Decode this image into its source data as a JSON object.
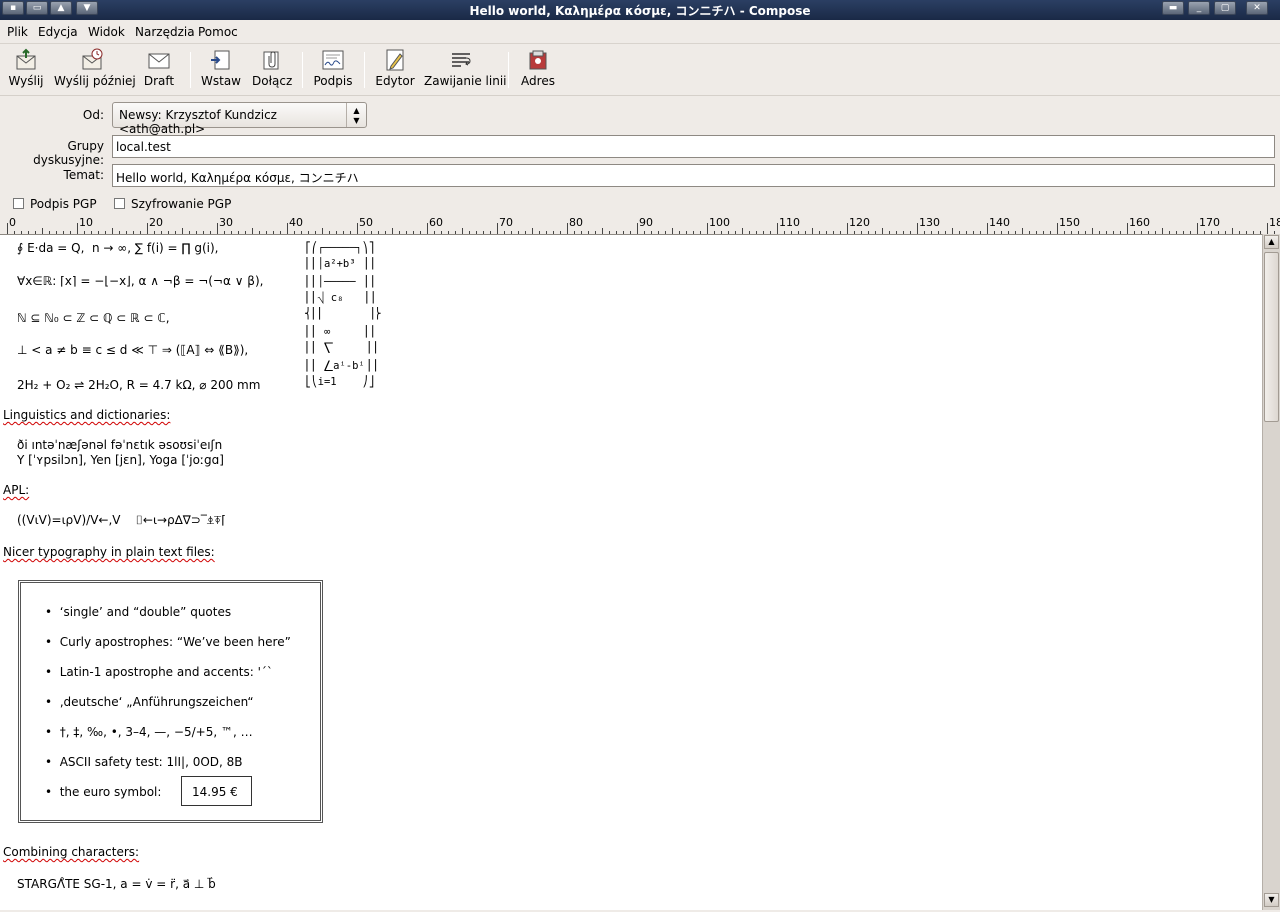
{
  "window": {
    "title": "Hello world, Καλημέρα κόσμε, コンニチハ - Compose"
  },
  "menu": {
    "items": [
      "Plik",
      "Edycja",
      "Widok",
      "Narzędzia",
      "Pomoc"
    ]
  },
  "toolbar": {
    "send": "Wyślij",
    "send_later": "Wyślij później",
    "draft": "Draft",
    "insert": "Wstaw",
    "attach": "Dołącz",
    "signature": "Podpis",
    "editor": "Edytor",
    "wrap": "Zawijanie linii",
    "address": "Adres"
  },
  "header": {
    "from_label": "Od:",
    "from_value": "Newsy: Krzysztof Kundzicz <ath@ath.pl>",
    "groups_label": "Grupy dyskusyjne:",
    "groups_value": "local.test",
    "subject_label": "Temat:",
    "subject_value": "Hello world, Καλημέρα κόσμε, コンニチハ",
    "pgp_sign": "Podpis PGP",
    "pgp_encrypt": "Szyfrowanie PGP"
  },
  "ruler": {
    "labels": [
      "0",
      "10",
      "20",
      "30",
      "40",
      "50",
      "60",
      "70",
      "80",
      "90",
      "100",
      "110",
      "120",
      "130",
      "140",
      "150",
      "160",
      "170",
      "18"
    ]
  },
  "body": {
    "math1": "∮ E⋅da = Q,  n → ∞, ∑ f(i) = ∏ g(i),",
    "math2": "∀x∈ℝ: ⌈x⌉ = −⌊−x⌋, α ∧ ¬β = ¬(¬α ∨ β),",
    "math3": "ℕ ⊆ ℕ₀ ⊂ ℤ ⊂ ℚ ⊂ ℝ ⊂ ℂ,",
    "math4": "⊥ < a ≠ b ≡ c ≤ d ≪ ⊤ ⇒ (⟦A⟧ ⇔ ⟪B⟫),",
    "math5": "2H₂ + O₂ ⇌ 2H₂O, R = 4.7 kΩ, ⌀ 200 mm",
    "mathbox": [
      "⎡⎛┌─────┐⎞⎤",
      "⎢⎜│a²+b³ ⎟⎥",
      "⎢⎜│───── ⎟⎥",
      "⎢⎜⎷ c₈   ⎟⎥",
      "⎨⎢⎜       ⎟⎬",
      "⎢⎜ ∞     ⎟⎥",
      "⎢⎜ ⎲     ⎟⎥",
      "⎢⎜ ⎳aⁱ-bⁱ⎟⎥",
      "⎣⎝i=1    ⎠⎦"
    ],
    "ling_head": "Linguistics and dictionaries:",
    "ling1": "ði ıntəˈnæʃənəl fəˈnɛtık əsoʊsiˈeıʃn",
    "ling2": "Y [ˈʏpsilɔn], Yen [jɛn], Yoga [ˈjoːgɑ]",
    "apl_head": "APL:",
    "apl1": "((V⍳V)=⍳⍴V)/V←,V    ⌷←⍳→⍴∆∇⊃‾⍎⍕⌈",
    "typo_head": "Nicer typography in plain text files:",
    "typo1": "•  ‘single’ and “double” quotes",
    "typo2": "•  Curly apostrophes: “We’ve been here”",
    "typo3": "•  Latin-1 apostrophe and accents: '´`",
    "typo4": "•  ‚deutsche‘ „Anführungszeichen“",
    "typo5": "•  †, ‡, ‰, •, 3–4, —, −5/+5, ™, …",
    "typo6": "•  ASCII safety test: 1lI|, 0OD, 8B",
    "typo7": "•  the euro symbol:",
    "euro": "14.95 €",
    "comb_head": "Combining characters:",
    "comb1": "STARGΛ̊TE SG-1, a = v̇ = r̈, a⃑ ⊥ b⃑"
  }
}
